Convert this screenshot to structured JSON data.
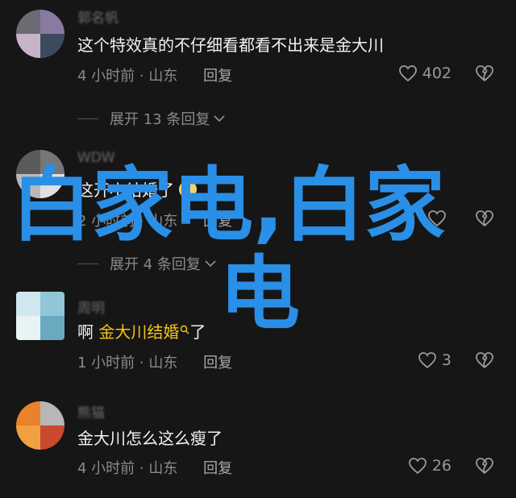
{
  "comments": [
    {
      "username": "郭名帆",
      "text": "这个特效真的不仔细看都看不出来是金大川",
      "time": "4 小时前",
      "location": "山东",
      "reply_label": "回复",
      "likes": "402",
      "expand_label": "展开 13 条回复",
      "avatar_colors": [
        "#6b6b73",
        "#8a7aa0",
        "#c7b4c8",
        "#3d4a5e"
      ]
    },
    {
      "username": "WDW",
      "text_pre": "这开",
      "text_hidden": "小结婚了",
      "time": "2 小时前",
      "location": "山东",
      "reply_label": "回复",
      "likes": "",
      "expand_label": "展开 4 条回复",
      "avatar_colors": [
        "#5a5a5a",
        "#777",
        "#b9b9b9",
        "#e0e0e0"
      ]
    },
    {
      "username": "周明",
      "text_pre": "啊 ",
      "text_link": "金大川结婚",
      "text_post": "了",
      "time": "1 小时前",
      "location": "山东",
      "reply_label": "回复",
      "likes": "3",
      "avatar_colors": [
        "#cfe8ef",
        "#8fc6d8",
        "#e8f3f5",
        "#6aa9c0"
      ]
    },
    {
      "username": "熊猫",
      "text": "金大川怎么这么瘦了",
      "time": "4 小时前",
      "location": "山东",
      "reply_label": "回复",
      "likes": "26",
      "avatar_colors": [
        "#e8822c",
        "#b7b7b7",
        "#f0a040",
        "#c94a2f"
      ]
    }
  ],
  "watermark": {
    "line1": "白家电,白家",
    "line2": "电",
    "color": "#2a8fe6"
  }
}
